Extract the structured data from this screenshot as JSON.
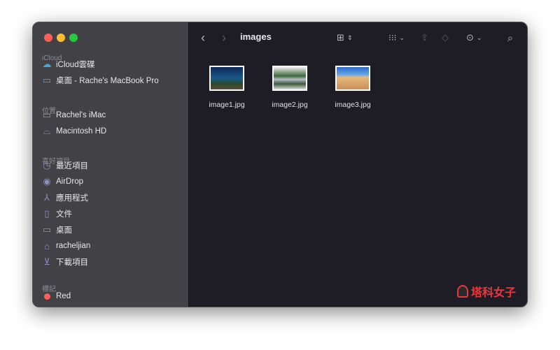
{
  "sidebar": {
    "sections": [
      {
        "title": "iCloud",
        "items": [
          {
            "label": "iCloud雲碟",
            "icon": "cloud-icon"
          },
          {
            "label": "桌面 - Rache's MacBook Pro",
            "icon": "folder-icon"
          }
        ]
      },
      {
        "title": "位置",
        "items": [
          {
            "label": "Rachel's iMac",
            "icon": "display-icon"
          },
          {
            "label": "Macintosh HD",
            "icon": "disk-icon"
          }
        ]
      },
      {
        "title": "喜好項目",
        "items": [
          {
            "label": "最近項目",
            "icon": "clock-icon"
          },
          {
            "label": "AirDrop",
            "icon": "airdrop-icon"
          },
          {
            "label": "應用程式",
            "icon": "apps-icon"
          },
          {
            "label": "文件",
            "icon": "document-icon"
          },
          {
            "label": "桌面",
            "icon": "desktop-icon"
          },
          {
            "label": "racheljian",
            "icon": "home-icon"
          },
          {
            "label": "下載項目",
            "icon": "download-icon"
          }
        ]
      },
      {
        "title": "標記",
        "items": [
          {
            "label": "Red",
            "icon": "red-tag-icon"
          }
        ]
      }
    ]
  },
  "toolbar": {
    "title": "images"
  },
  "files": [
    {
      "name": "image1.jpg"
    },
    {
      "name": "image2.jpg"
    },
    {
      "name": "image3.jpg"
    }
  ],
  "watermark": {
    "text": "塔科女子"
  },
  "colors": {
    "accent": "#4aa8d8",
    "red": "#ff5f57",
    "yellow": "#febc2e",
    "green": "#28c840",
    "watermark": "#e8383d"
  }
}
